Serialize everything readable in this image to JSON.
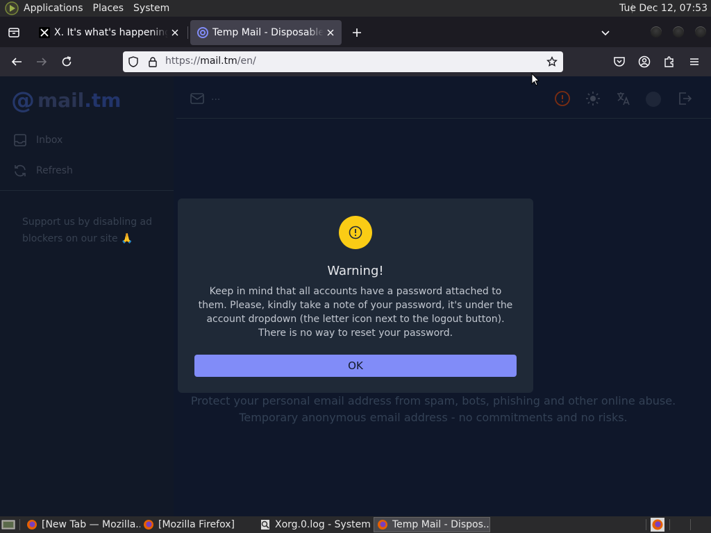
{
  "top_panel": {
    "menus": [
      "Applications",
      "Places",
      "System"
    ],
    "clock": "Tue Dec 12, 07:53"
  },
  "browser": {
    "tabs": [
      {
        "title": "X. It's what's happening / X",
        "favicon": "x-logo-icon",
        "active": false
      },
      {
        "title": "Temp Mail - Disposable Temporary Email",
        "favicon": "mailtm-logo-icon",
        "active": true
      }
    ],
    "url": {
      "scheme": "https://",
      "host": "mail.tm",
      "path": "/en/"
    }
  },
  "page": {
    "brand": {
      "at": "@",
      "name": "mail",
      "tld": ".tm"
    },
    "sidebar": {
      "items": [
        {
          "label": "Inbox",
          "icon": "inbox-icon"
        },
        {
          "label": "Refresh",
          "icon": "refresh-icon"
        }
      ],
      "ad_note": "Support us by disabling ad blockers on our site 🙏"
    },
    "header": {
      "address": "..."
    },
    "hero": {
      "line1": "Protect your personal email address from spam, bots, phishing and other online abuse.",
      "line2": "Temporary anonymous email address - no commitments and no risks."
    }
  },
  "modal": {
    "icon": "exclamation-icon",
    "title": "Warning!",
    "body": "Keep in mind that all accounts have a password attached to them. Please, kindly take a note of your password, it's under the account dropdown (the letter icon next to the logout button). There is no way to reset your password.",
    "ok_label": "OK"
  },
  "taskbar": {
    "tasks": [
      {
        "label": "[New Tab — Mozilla...",
        "icon": "firefox-icon",
        "active": false
      },
      {
        "label": "[Mozilla Firefox]",
        "icon": "firefox-icon",
        "active": false
      },
      {
        "label": "Xorg.0.log - System ...",
        "icon": "log-viewer-icon",
        "active": false
      },
      {
        "label": "Temp Mail - Dispos...",
        "icon": "firefox-icon",
        "active": true
      }
    ]
  },
  "colors": {
    "accent": "#818cf8",
    "warning": "#facc15",
    "modal_bg": "#1f2937",
    "page_bg": "#0f172a"
  }
}
